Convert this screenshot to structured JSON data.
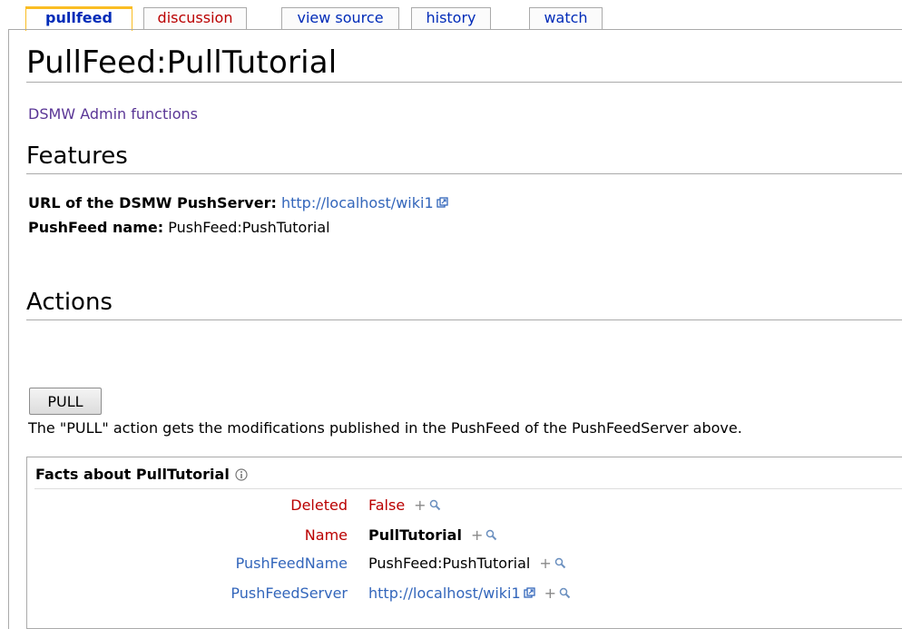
{
  "tabs": [
    {
      "label": "pullfeed",
      "state": "selected"
    },
    {
      "label": "discussion",
      "state": "new"
    },
    {
      "label": "view source",
      "state": "normal"
    },
    {
      "label": "history",
      "state": "normal"
    },
    {
      "label": "watch",
      "state": "normal"
    }
  ],
  "page": {
    "title": "PullFeed:PullTutorial",
    "admin_link": "DSMW Admin functions"
  },
  "features": {
    "heading": "Features",
    "url_label": "URL of the DSMW PushServer:",
    "url_value": "http://localhost/wiki1",
    "name_label": "PushFeed name:",
    "name_value": "PushFeed:PushTutorial"
  },
  "actions": {
    "heading": "Actions",
    "pull_button": "PULL",
    "description": "The \"PULL\" action gets the modifications published in the PushFeed of the PushFeedServer above."
  },
  "facts": {
    "title": "Facts about PullTutorial",
    "rows": [
      {
        "property": "Deleted",
        "value": "False",
        "property_color": "#ba0000",
        "value_color": "#ba0000"
      },
      {
        "property": "Name",
        "value": "PullTutorial",
        "property_color": "#ba0000",
        "value_style": "bold"
      },
      {
        "property": "PushFeedName",
        "value": "PushFeed:PushTutorial",
        "property_color": "#3366bb"
      },
      {
        "property": "PushFeedServer",
        "value": "http://localhost/wiki1",
        "property_color": "#3366bb",
        "value_color": "#3366bb",
        "external": true
      }
    ],
    "plus": "+"
  },
  "colors": {
    "link_blue": "#3366bb",
    "link_red": "#ba0000",
    "visited_purple": "#5a3696",
    "tab_accent": "#fabd23"
  },
  "icons": [
    "external-link-icon",
    "info-icon",
    "magnifier-icon"
  ]
}
